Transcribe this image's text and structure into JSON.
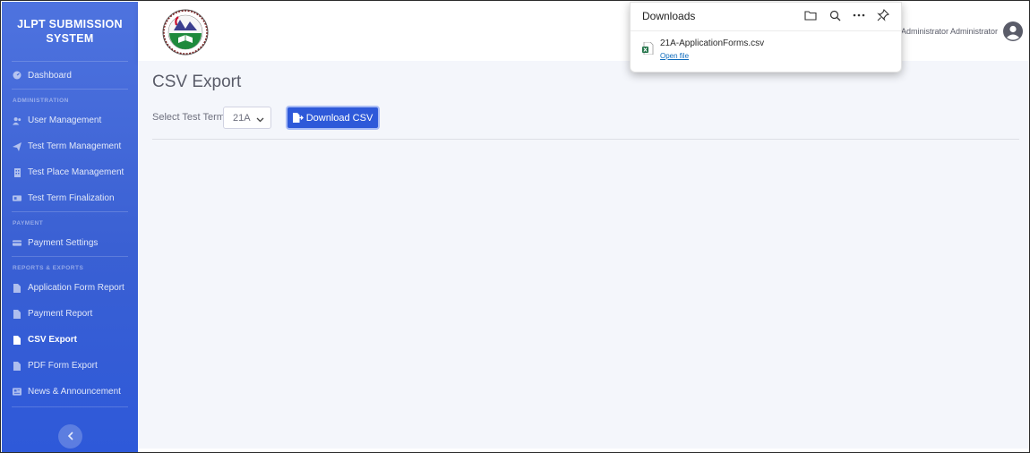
{
  "sidebar": {
    "brand": "JLPT SUBMISSION SYSTEM",
    "dashboard": "Dashboard",
    "sections": {
      "administration": "ADMINISTRATION",
      "payment": "PAYMENT",
      "reports": "REPORTS & EXPORTS"
    },
    "items": {
      "user_management": "User Management",
      "test_term_management": "Test Term Management",
      "test_place_management": "Test Place Management",
      "test_term_finalization": "Test Term Finalization",
      "payment_settings": "Payment Settings",
      "application_form_report": "Application Form Report",
      "payment_report": "Payment Report",
      "csv_export": "CSV Export",
      "pdf_form_export": "PDF Form Export",
      "news_announcement": "News & Announcement"
    },
    "toggle_icon": "chevron-left-icon"
  },
  "topbar": {
    "user_name": "Administrator Administrator"
  },
  "main": {
    "page_title": "CSV Export",
    "term_label": "Select Test Term",
    "term_value": "21A",
    "download_button": "Download CSV"
  },
  "downloads": {
    "title": "Downloads",
    "file_name": "21A-ApplicationForms.csv",
    "open_link": "Open file"
  },
  "colors": {
    "sidebar": "#4e73df",
    "primary_button": "#2e59d9",
    "content_bg": "#f4f6fb",
    "link": "#0f6cbd"
  }
}
